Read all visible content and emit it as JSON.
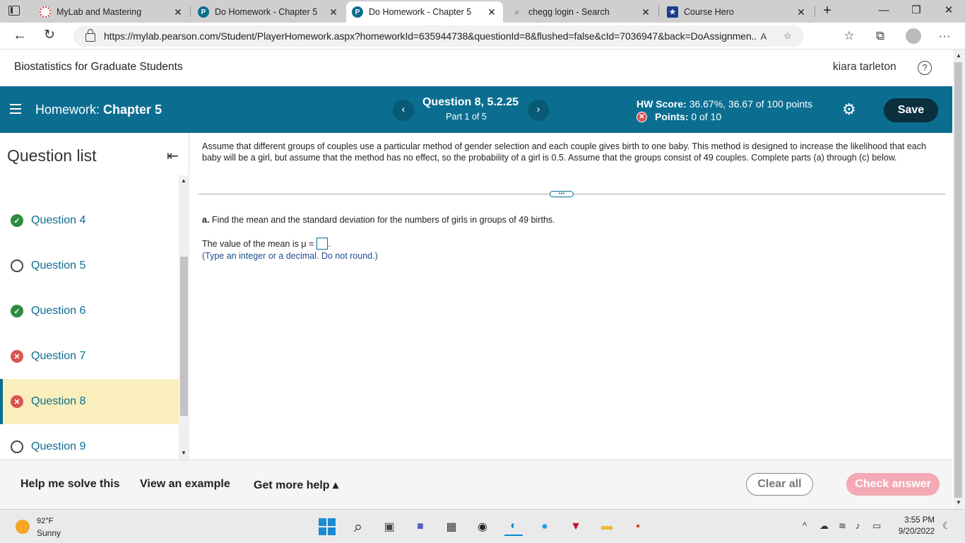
{
  "browser": {
    "tabs": [
      {
        "title": "MyLab and Mastering",
        "icon": "mylab-icon"
      },
      {
        "title": "Do Homework - Chapter 5",
        "icon": "pearson-icon"
      },
      {
        "title": "Do Homework - Chapter 5",
        "icon": "pearson-icon",
        "active": true
      },
      {
        "title": "chegg login - Search",
        "icon": "search-icon"
      },
      {
        "title": "Course Hero",
        "icon": "coursehero-icon"
      }
    ],
    "url": "https://mylab.pearson.com/Student/PlayerHomework.aspx?homeworkId=635944738&questionId=8&flushed=false&cId=7036947&back=DoAssignmen...",
    "colors": {
      "pearson": "#0b6e91",
      "mylab": "#e0303a",
      "coursehero": "#1d3c8f"
    }
  },
  "course": {
    "title": "Biostatistics for Graduate Students",
    "user": "kiara tarleton"
  },
  "hwbar": {
    "label_prefix": "Homework:",
    "label_name": "Chapter 5",
    "question_title": "Question 8, 5.2.25",
    "question_part": "Part 1 of 5",
    "hw_score_label": "HW Score:",
    "hw_score_value": "36.67%, 36.67 of 100 points",
    "points_label": "Points:",
    "points_value": "0 of 10",
    "save_label": "Save",
    "color": "#0b6e91"
  },
  "question_list": {
    "heading": "Question list",
    "items": [
      {
        "label": "Question 4",
        "status": "correct"
      },
      {
        "label": "Question 5",
        "status": "unanswered"
      },
      {
        "label": "Question 6",
        "status": "correct"
      },
      {
        "label": "Question 7",
        "status": "incorrect"
      },
      {
        "label": "Question 8",
        "status": "incorrect",
        "current": true
      },
      {
        "label": "Question 9",
        "status": "unanswered"
      }
    ]
  },
  "question": {
    "text": "Assume that different groups of couples use a particular method of gender selection and each couple gives birth to one baby. This method is designed to increase the likelihood that each baby will be a girl, but assume that the method has no effect, so the probability of a girl is 0.5. Assume that the groups consist of 49 couples. Complete parts (a) through (c) below.",
    "part_a_prefix": "a.",
    "part_a_text": "Find the mean and the standard deviation for the numbers of girls in groups of 49 births.",
    "mean_prompt": "The value of the mean is μ =",
    "mean_value": "",
    "hint": "(Type an integer or a decimal. Do not round.)",
    "more_label": "•••"
  },
  "bottom": {
    "help_solve": "Help me solve this",
    "view_example": "View an example",
    "more_help": "Get more help ▴",
    "clear_all": "Clear all",
    "check_answer": "Check answer"
  },
  "taskbar": {
    "temp": "92°F",
    "condition": "Sunny",
    "time": "3:55 PM",
    "date": "9/20/2022"
  }
}
